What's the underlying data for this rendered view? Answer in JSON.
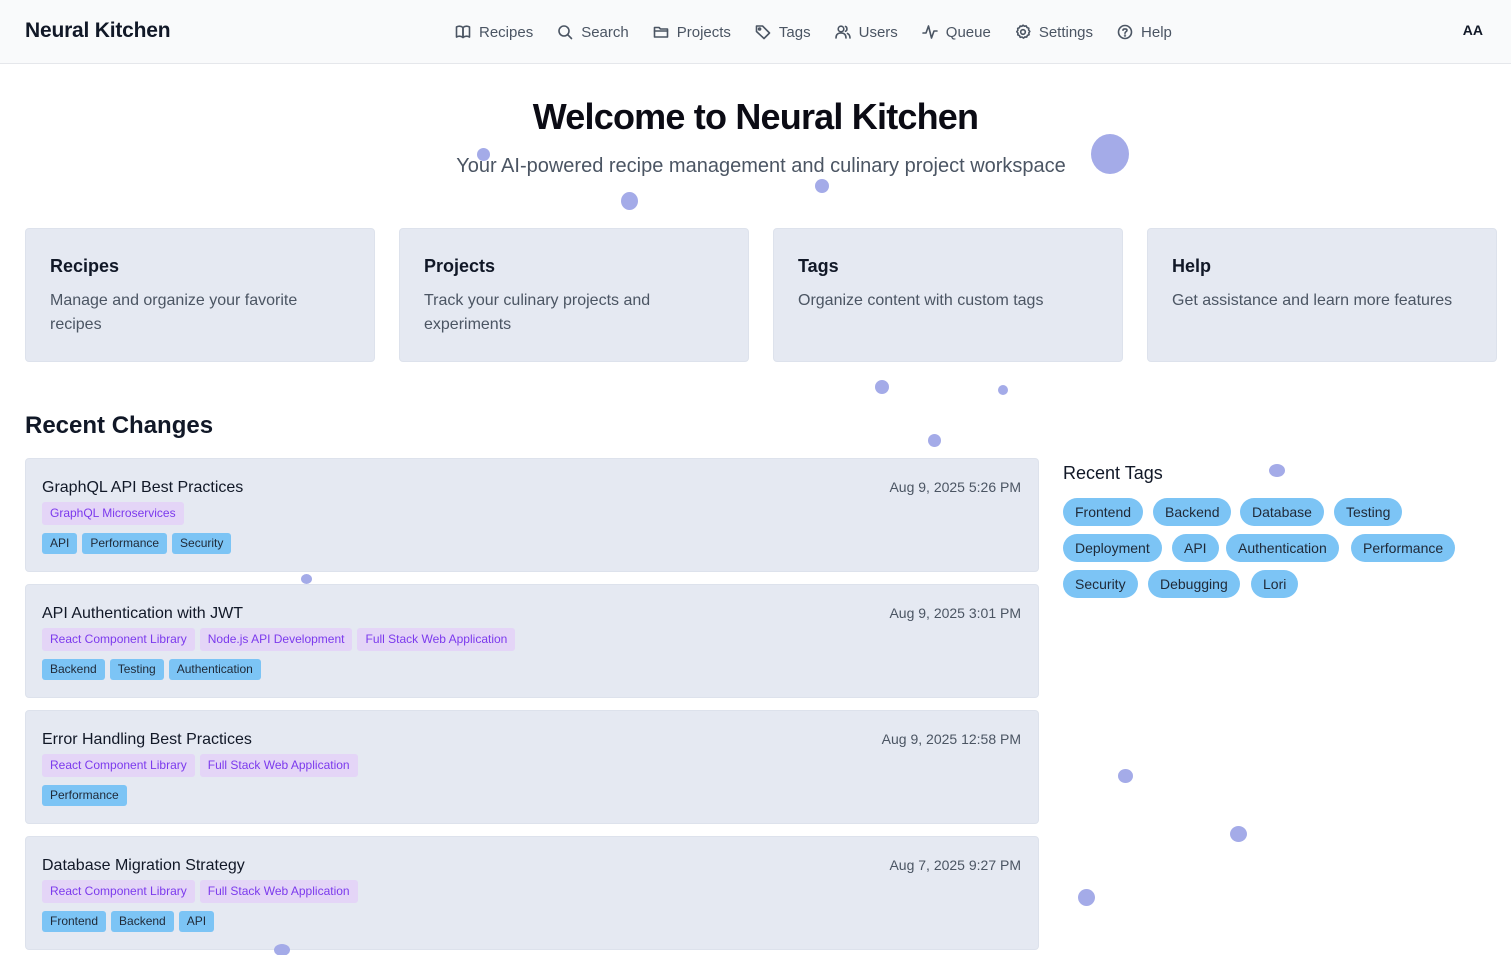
{
  "header": {
    "brand": "Neural Kitchen",
    "nav": [
      {
        "label": "Recipes",
        "icon": "book-icon"
      },
      {
        "label": "Search",
        "icon": "search-icon"
      },
      {
        "label": "Projects",
        "icon": "folder-icon"
      },
      {
        "label": "Tags",
        "icon": "tag-icon"
      },
      {
        "label": "Users",
        "icon": "users-icon"
      },
      {
        "label": "Queue",
        "icon": "activity-icon"
      },
      {
        "label": "Settings",
        "icon": "gear-icon"
      },
      {
        "label": "Help",
        "icon": "help-icon"
      }
    ],
    "avatar": "AA"
  },
  "hero": {
    "title": "Welcome to Neural Kitchen",
    "subtitle": "Your AI-powered recipe management and culinary project workspace"
  },
  "cards": [
    {
      "title": "Recipes",
      "description": "Manage and organize your favorite recipes"
    },
    {
      "title": "Projects",
      "description": "Track your culinary projects and experiments"
    },
    {
      "title": "Tags",
      "description": "Organize content with custom tags"
    },
    {
      "title": "Help",
      "description": "Get assistance and learn more features"
    }
  ],
  "recent_changes": {
    "title": "Recent Changes",
    "items": [
      {
        "title": "GraphQL API Best Practices",
        "date": "Aug 9, 2025 5:26 PM",
        "projects": [
          "GraphQL Microservices"
        ],
        "tags": [
          "API",
          "Performance",
          "Security"
        ]
      },
      {
        "title": "API Authentication with JWT",
        "date": "Aug 9, 2025 3:01 PM",
        "projects": [
          "React Component Library",
          "Node.js API Development",
          "Full Stack Web Application"
        ],
        "tags": [
          "Backend",
          "Testing",
          "Authentication"
        ]
      },
      {
        "title": "Error Handling Best Practices",
        "date": "Aug 9, 2025 12:58 PM",
        "projects": [
          "React Component Library",
          "Full Stack Web Application"
        ],
        "tags": [
          "Performance"
        ]
      },
      {
        "title": "Database Migration Strategy",
        "date": "Aug 7, 2025 9:27 PM",
        "projects": [
          "React Component Library",
          "Full Stack Web Application"
        ],
        "tags": [
          "Frontend",
          "Backend",
          "API"
        ]
      }
    ]
  },
  "recent_tags": {
    "title": "Recent Tags",
    "tags": [
      "Frontend",
      "Backend",
      "Database",
      "Testing",
      "Deployment",
      "API",
      "Authentication",
      "Performance",
      "Security",
      "Debugging",
      "Lori"
    ]
  },
  "colors": {
    "card_bg": "#e5e9f2",
    "project_badge_bg": "#e4d5f7",
    "project_badge_text": "#7c3aed",
    "tag_bg": "#7cc4f5",
    "dot": "#a4abe8"
  }
}
